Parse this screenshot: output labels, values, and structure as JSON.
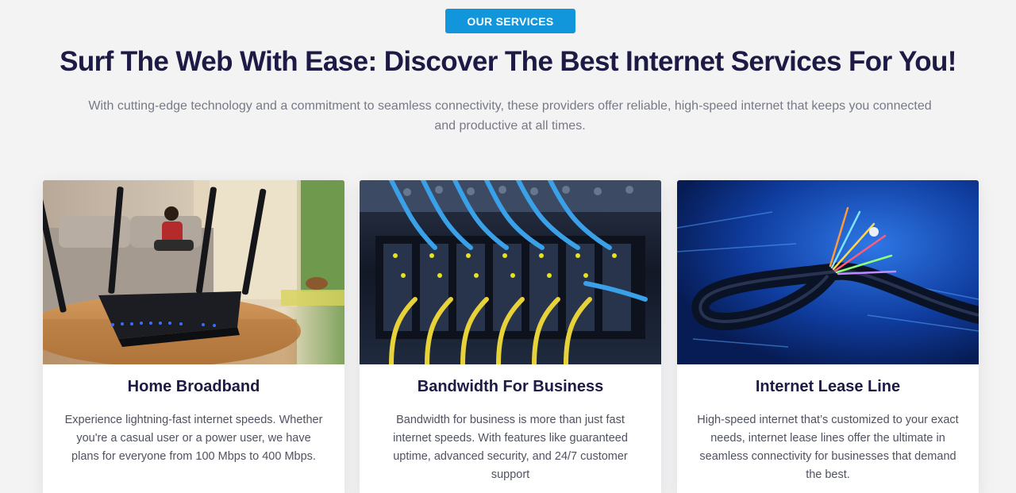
{
  "section": {
    "badge": "OUR SERVICES",
    "headline": "Surf The Web With Ease: Discover The Best Internet Services For You!",
    "subtext": "With cutting-edge technology and a commitment to seamless connectivity, these providers offer reliable, high-speed internet that keeps you connected and productive at all times."
  },
  "cards": [
    {
      "title": "Home Broadband",
      "text": "Experience lightning-fast internet speeds. Whether you're a casual user or a power user, we have plans for everyone from 100 Mbps to 400 Mbps.",
      "image": "router-photo"
    },
    {
      "title": "Bandwidth For Business",
      "text": "Bandwidth for business is more than just fast internet speeds. With features like guaranteed uptime, advanced security, and 24/7 customer support",
      "image": "server-rack-photo"
    },
    {
      "title": "Internet Lease Line",
      "text": "High-speed internet that’s customized to your exact needs, internet lease lines offer the ultimate in seamless connectivity for businesses that demand the best.",
      "image": "fiber-optic-cable-photo"
    }
  ],
  "colors": {
    "accent": "#1296db",
    "heading": "#1d1b45",
    "body_text": "#777a86",
    "background": "#f3f3f4"
  }
}
